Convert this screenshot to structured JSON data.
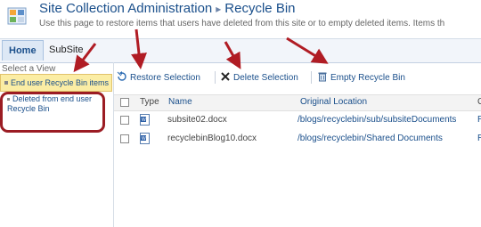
{
  "header": {
    "site_title": "Site Collection Administration",
    "separator": "▸",
    "page_title": "Recycle Bin",
    "description": "Use this page to restore items that users have deleted from this site or to empty deleted items. Items th"
  },
  "nav": {
    "tabs": [
      {
        "label": "Home",
        "selected": true
      },
      {
        "label": "SubSite",
        "selected": false
      }
    ]
  },
  "view_panel": {
    "label": "Select a View",
    "views": [
      {
        "label": "End user Recycle Bin items",
        "selected": true
      },
      {
        "label": "Deleted from end user Recycle Bin",
        "selected": false
      }
    ]
  },
  "toolbar": {
    "restore_label": "Restore Selection",
    "delete_label": "Delete Selection",
    "empty_label": "Empty Recycle Bin"
  },
  "table": {
    "columns": [
      "Type",
      "Name",
      "Original Location"
    ],
    "truncated_column": "C",
    "rows": [
      {
        "type": "word-doc-icon",
        "name": "subsite02.docx",
        "location": "/blogs/recyclebin/sub/subsiteDocuments",
        "extra": "R"
      },
      {
        "type": "word-doc-icon",
        "name": "recyclebinBlog10.docx",
        "location": "/blogs/recyclebin/Shared Documents",
        "extra": "R"
      }
    ]
  },
  "colors": {
    "link": "#1a4f8b",
    "highlight_box": "#9b1c23",
    "arrow": "#b01c24",
    "selected_view_bg": "#fbeda4"
  }
}
